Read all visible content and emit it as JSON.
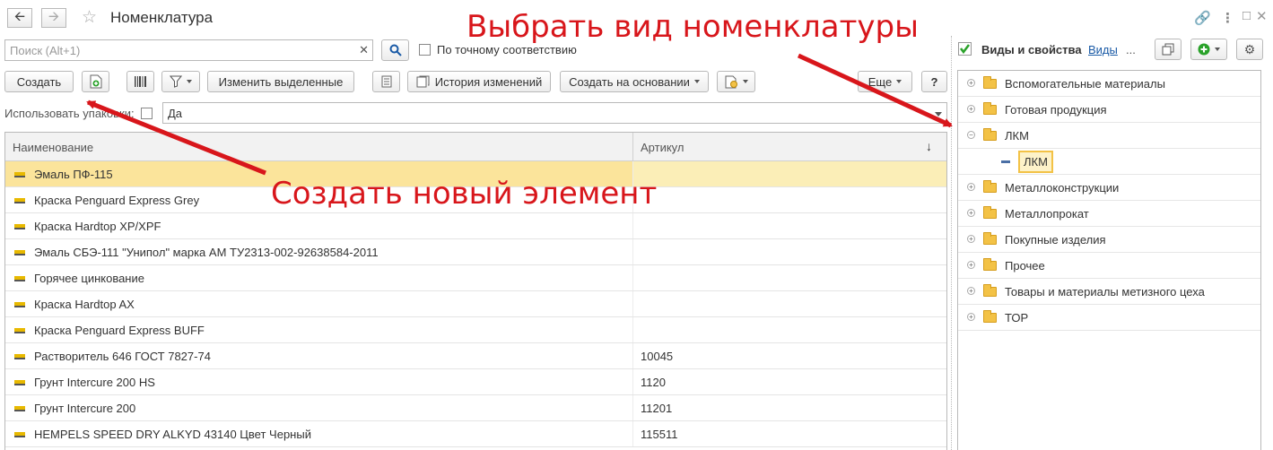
{
  "header": {
    "title": "Номенклатура",
    "back_icon": "arrow-left-icon",
    "forward_icon": "arrow-right-icon",
    "favorite_icon": "star-icon"
  },
  "search": {
    "placeholder": "Поиск (Alt+1)",
    "exact_match_label": "По точному соответствию"
  },
  "toolbar": {
    "create_label": "Создать",
    "change_selected_label": "Изменить выделенные",
    "history_label": "История изменений",
    "create_based_label": "Создать на основании",
    "more_label": "Еще",
    "help_label": "?"
  },
  "filter": {
    "use_packaging_label": "Использовать упаковки:",
    "use_packaging_value": "Да"
  },
  "table": {
    "col_name": "Наименование",
    "col_article": "Артикул",
    "sort_icon": "sort-down-icon",
    "rows": [
      {
        "name": "Эмаль ПФ-115",
        "article": ""
      },
      {
        "name": "Краска Penguard Express Grey",
        "article": ""
      },
      {
        "name": "Краска Hardtop XP/XPF",
        "article": ""
      },
      {
        "name": "Эмаль СБЭ-111 \"Унипол\" марка АМ ТУ2313-002-92638584-2011",
        "article": ""
      },
      {
        "name": "Горячее цинкование",
        "article": ""
      },
      {
        "name": "Краска Hardtop AX",
        "article": ""
      },
      {
        "name": "Краска Penguard Express BUFF",
        "article": ""
      },
      {
        "name": "Растворитель 646 ГОСТ 7827-74",
        "article": "10045"
      },
      {
        "name": "Грунт Intercure 200 HS",
        "article": "1120"
      },
      {
        "name": "Грунт Intercure 200",
        "article": "11201"
      },
      {
        "name": "HEMPELS SPEED DRY ALKYD 43140 Цвет Черный",
        "article": "115511"
      }
    ]
  },
  "panel": {
    "title": "Виды и свойства",
    "link": "Виды",
    "ellipsis": "...",
    "tree": [
      {
        "label": "Вспомогательные материалы",
        "expander": "+"
      },
      {
        "label": "Готовая продукция",
        "expander": "+"
      },
      {
        "label": "ЛКМ",
        "expander": "−"
      },
      {
        "label": "ЛКМ",
        "expander": ""
      },
      {
        "label": "Металлоконструкции",
        "expander": "+"
      },
      {
        "label": "Металлопрокат",
        "expander": "+"
      },
      {
        "label": "Покупные изделия",
        "expander": "+"
      },
      {
        "label": "Прочее",
        "expander": "+"
      },
      {
        "label": "Товары и материалы метизного цеха",
        "expander": "+"
      },
      {
        "label": "ТОР",
        "expander": "+"
      }
    ]
  },
  "annotations": {
    "top": "Выбрать вид номенклатуры",
    "bottom": "Создать новый элемент"
  },
  "colors": {
    "annotation": "#d8161b",
    "selected_row": "#fbe49b",
    "add_button": "#2aa22a",
    "panel_check": "#2aa22a",
    "link": "#1a5aa6"
  }
}
